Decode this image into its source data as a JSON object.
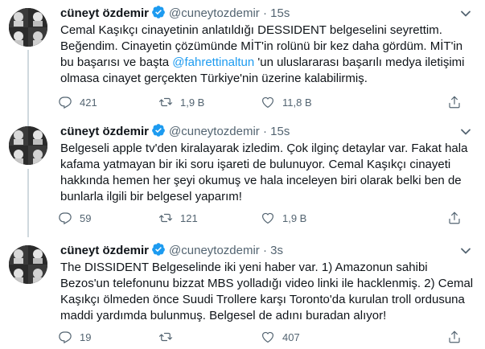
{
  "tweets": [
    {
      "name": "cüneyt özdemir",
      "handle": "@cuneytozdemir",
      "time": "15s",
      "text_a": "Cemal Kaşıkçı cinayetinin anlatıldığı DESSIDENT belgeselini seyrettim. Beğendim. Cinayetin çözümünde MİT'in rolünü bir kez daha gördüm. MİT'in bu başarısı ve başta ",
      "mention": "@fahrettinaltun",
      "text_b": " 'un uluslararası başarılı medya iletişimi olmasa cinayet gerçekten Türkiye'nin üzerine kalabilirmiş.",
      "replies": "421",
      "retweets": "1,9 B",
      "likes": "11,8 B"
    },
    {
      "name": "cüneyt özdemir",
      "handle": "@cuneytozdemir",
      "time": "15s",
      "text": "Belgeseli apple tv'den kiralayarak izledim. Çok ilginç detaylar var. Fakat hala kafama yatmayan bir iki soru işareti de bulunuyor. Cemal Kaşıkçı cinayeti hakkında hemen her şeyi okumuş ve hala inceleyen biri olarak belki ben de bunlarla ilgili bir belgesel yaparım!",
      "replies": "59",
      "retweets": "121",
      "likes": "1,9 B"
    },
    {
      "name": "cüneyt özdemir",
      "handle": "@cuneytozdemir",
      "time": "3s",
      "text": "The DISSIDENT Belgeselinde iki yeni haber var. 1) Amazonun sahibi Bezos'un telefonunu bizzat MBS yolladığı video linki ile hacklenmiş. 2) Cemal Kaşıkçı ölmeden önce Suudi Trollere karşı Toronto'da kurulan troll ordusuna maddi yardımda bulunmuş. Belgesel de adını buradan alıyor!",
      "replies": "19",
      "retweets": "",
      "likes": "407"
    }
  ],
  "colors": {
    "accent": "#1d9bf0",
    "muted": "#536471",
    "text": "#0f1419",
    "line": "#cfd9de"
  }
}
